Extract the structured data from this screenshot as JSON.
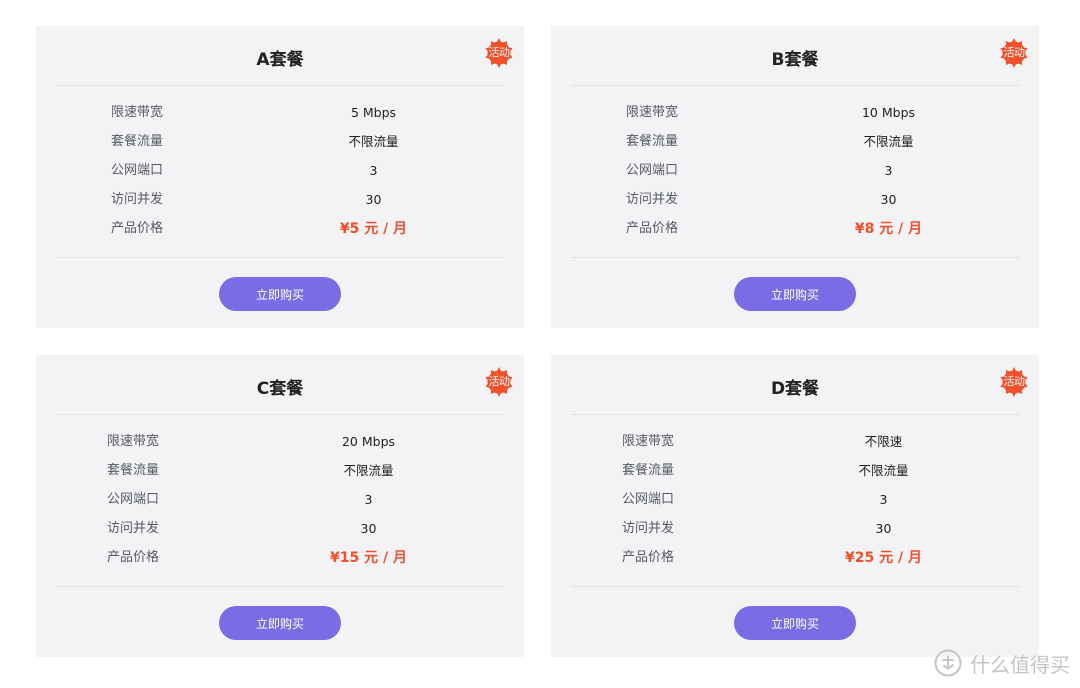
{
  "colors": {
    "card_bg": "#f3f3f5",
    "price": "#f0502a",
    "button": "#7b6ce6",
    "badge": "#f0502a"
  },
  "plans": [
    {
      "title": "A套餐",
      "badge": "活动",
      "specs": [
        {
          "label": "限速带宽",
          "value": "5 Mbps"
        },
        {
          "label": "套餐流量",
          "value": "不限流量"
        },
        {
          "label": "公网端口",
          "value": "3"
        },
        {
          "label": "访问并发",
          "value": "30"
        },
        {
          "label": "产品价格",
          "value": "¥5 元 / 月"
        }
      ],
      "button": "立即购买"
    },
    {
      "title": "B套餐",
      "badge": "活动",
      "specs": [
        {
          "label": "限速带宽",
          "value": "10 Mbps"
        },
        {
          "label": "套餐流量",
          "value": "不限流量"
        },
        {
          "label": "公网端口",
          "value": "3"
        },
        {
          "label": "访问并发",
          "value": "30"
        },
        {
          "label": "产品价格",
          "value": "¥8 元 / 月"
        }
      ],
      "button": "立即购买"
    },
    {
      "title": "C套餐",
      "badge": "活动",
      "specs": [
        {
          "label": "限速带宽",
          "value": "20 Mbps"
        },
        {
          "label": "套餐流量",
          "value": "不限流量"
        },
        {
          "label": "公网端口",
          "value": "3"
        },
        {
          "label": "访问并发",
          "value": "30"
        },
        {
          "label": "产品价格",
          "value": "¥15 元 / 月"
        }
      ],
      "button": "立即购买"
    },
    {
      "title": "D套餐",
      "badge": "活动",
      "specs": [
        {
          "label": "限速带宽",
          "value": "不限速"
        },
        {
          "label": "套餐流量",
          "value": "不限流量"
        },
        {
          "label": "公网端口",
          "value": "3"
        },
        {
          "label": "访问并发",
          "value": "30"
        },
        {
          "label": "产品价格",
          "value": "¥25 元 / 月"
        }
      ],
      "button": "立即购买"
    }
  ],
  "watermark": {
    "text": "什么值得买",
    "icon": "smzdm-logo-icon"
  }
}
